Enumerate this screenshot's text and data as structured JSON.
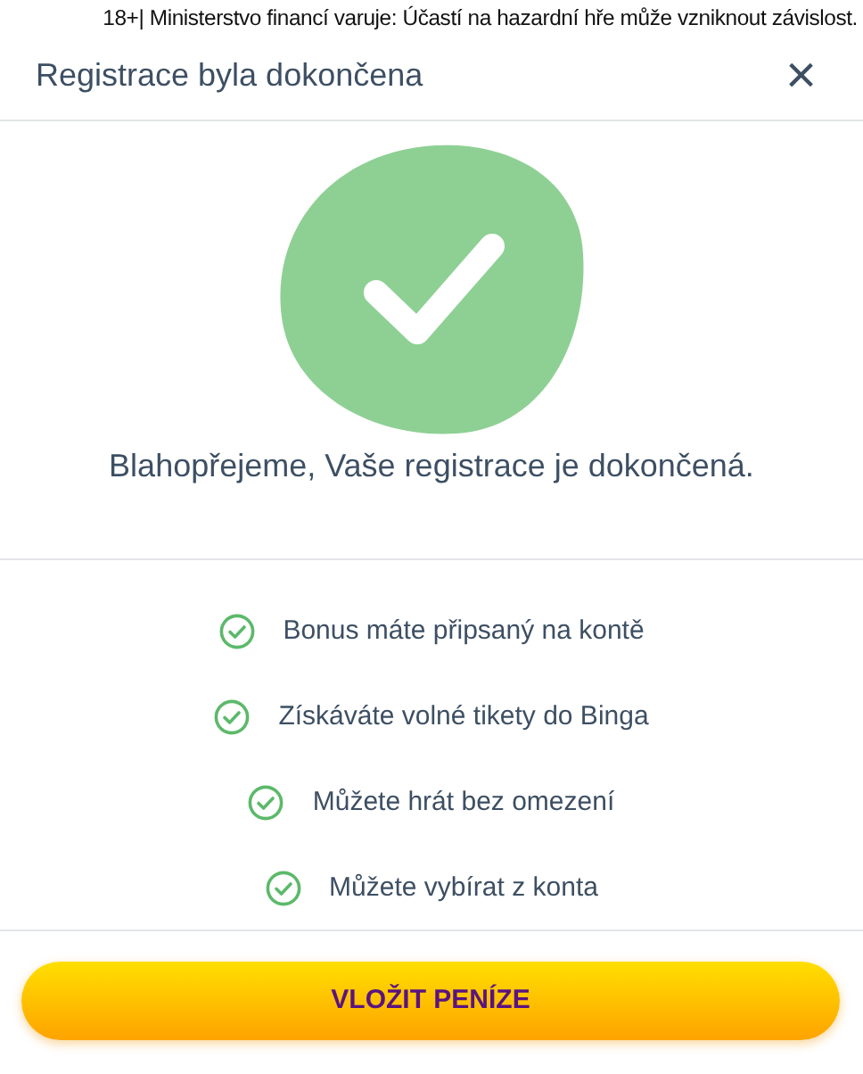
{
  "warning": "18+| Ministerstvo financí varuje: Účastí na hazardní hře může vzniknout závislost.",
  "dialog": {
    "title": "Registrace byla dokončena",
    "close": "×"
  },
  "message": "Blahopřejeme, Vaše registrace je dokončená.",
  "benefits": [
    {
      "text": "Bonus máte připsaný na kontě"
    },
    {
      "text": "Získáváte volné tikety do Binga"
    },
    {
      "text": "Můžete hrát bez omezení"
    },
    {
      "text": "Můžete vybírat z konta"
    }
  ],
  "button": "VLOŽIT PENÍZE"
}
